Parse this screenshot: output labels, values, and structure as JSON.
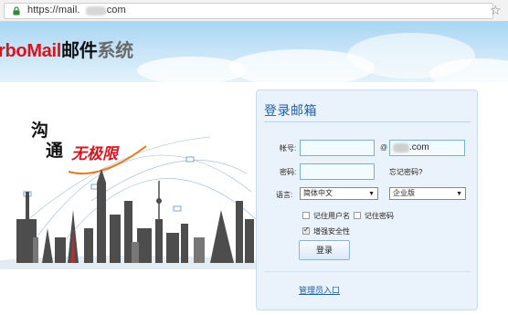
{
  "browser": {
    "url_prefix": "https://mail.",
    "url_suffix": ".com"
  },
  "banner": {
    "brand_part1": "rboMail",
    "brand_part2": "邮件",
    "brand_part3": "系统"
  },
  "hero": {
    "slogan_1": "沟",
    "slogan_2": "通",
    "slogan_3": "无极限"
  },
  "login": {
    "title": "登录邮箱",
    "account_label": "帐号:",
    "account_value": "",
    "at_sign": "@",
    "domain_suffix": ".com",
    "password_label": "密码:",
    "password_value": "",
    "forgot_label": "忘记密码?",
    "language_label": "语言:",
    "language_value": "简体中文",
    "edition_value": "企业版",
    "remember_user_label": "记住用户名",
    "remember_password_label": "记住密码",
    "enhance_security_label": "增强安全性",
    "remember_user_checked": false,
    "remember_password_checked": false,
    "enhance_security_checked": true,
    "login_button": "登录",
    "admin_link": "管理员入口"
  },
  "colors": {
    "brand_red": "#d8141e",
    "link_blue": "#1f5ea8",
    "panel_bg": "#eaf3fb"
  }
}
